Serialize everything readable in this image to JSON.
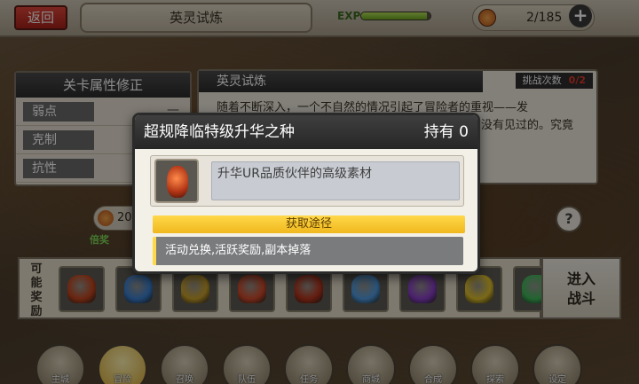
{
  "topbar": {
    "back_label": "返回",
    "title": "英灵试炼",
    "exp_label": "EXP",
    "exp_fraction": 0.95,
    "stamina": "2/185",
    "plus": "+"
  },
  "attributes": {
    "title": "关卡属性修正",
    "rows": [
      {
        "label": "弱点",
        "value": "—"
      },
      {
        "label": "克制",
        "value": "—"
      },
      {
        "label": "抗性",
        "value": "—"
      }
    ]
  },
  "description": {
    "title": "英灵试炼",
    "challenge_label": "挑战次数",
    "challenge_count": "0/2",
    "text_line1": "随着不断深入，一个不自然的情况引起了冒险者的重视——发",
    "text_line2": "现了一个之前没有见过的。究竟"
  },
  "cost": {
    "value": "20",
    "tag": "倍奖"
  },
  "help": "?",
  "rewards": {
    "label_chars": [
      "可",
      "能",
      "奖",
      "励"
    ],
    "items": [
      {
        "icon": "ascension-seed-icon",
        "color": "#c2461e"
      },
      {
        "icon": "blue-crystal-icon",
        "color": "#3a7fd0"
      },
      {
        "icon": "gold-armor-icon",
        "color": "#c9a02a"
      },
      {
        "icon": "red-crystal-icon",
        "color": "#d04a2a"
      },
      {
        "icon": "red-seed-icon",
        "color": "#b8351c"
      },
      {
        "icon": "blue-orb-icon",
        "color": "#4f9be0"
      },
      {
        "icon": "purple-crystal-icon",
        "color": "#8a3fc9"
      },
      {
        "icon": "yellow-gem-icon",
        "color": "#e0c02a"
      },
      {
        "icon": "green-gem-icon",
        "color": "#3fb85a"
      }
    ]
  },
  "battle_button": {
    "line1": "进入",
    "line2": "战斗"
  },
  "nav": [
    {
      "label": "主城",
      "icon": "castle-icon"
    },
    {
      "label": "冒险",
      "icon": "swords-icon",
      "active": true
    },
    {
      "label": "召唤",
      "icon": "summon-icon"
    },
    {
      "label": "队伍",
      "icon": "team-icon"
    },
    {
      "label": "任务",
      "icon": "quest-icon"
    },
    {
      "label": "商城",
      "icon": "shop-icon"
    },
    {
      "label": "合成",
      "icon": "craft-icon"
    },
    {
      "label": "探索",
      "icon": "explore-icon"
    },
    {
      "label": "设定",
      "icon": "settings-icon"
    }
  ],
  "popup": {
    "title": "超规降临特级升华之种",
    "own_label": "持有",
    "own_count": "0",
    "description": "升华UR品质伙伴的高级素材",
    "source_title": "获取途径",
    "source_text": "活动兑换,活跃奖励,副本掉落"
  }
}
